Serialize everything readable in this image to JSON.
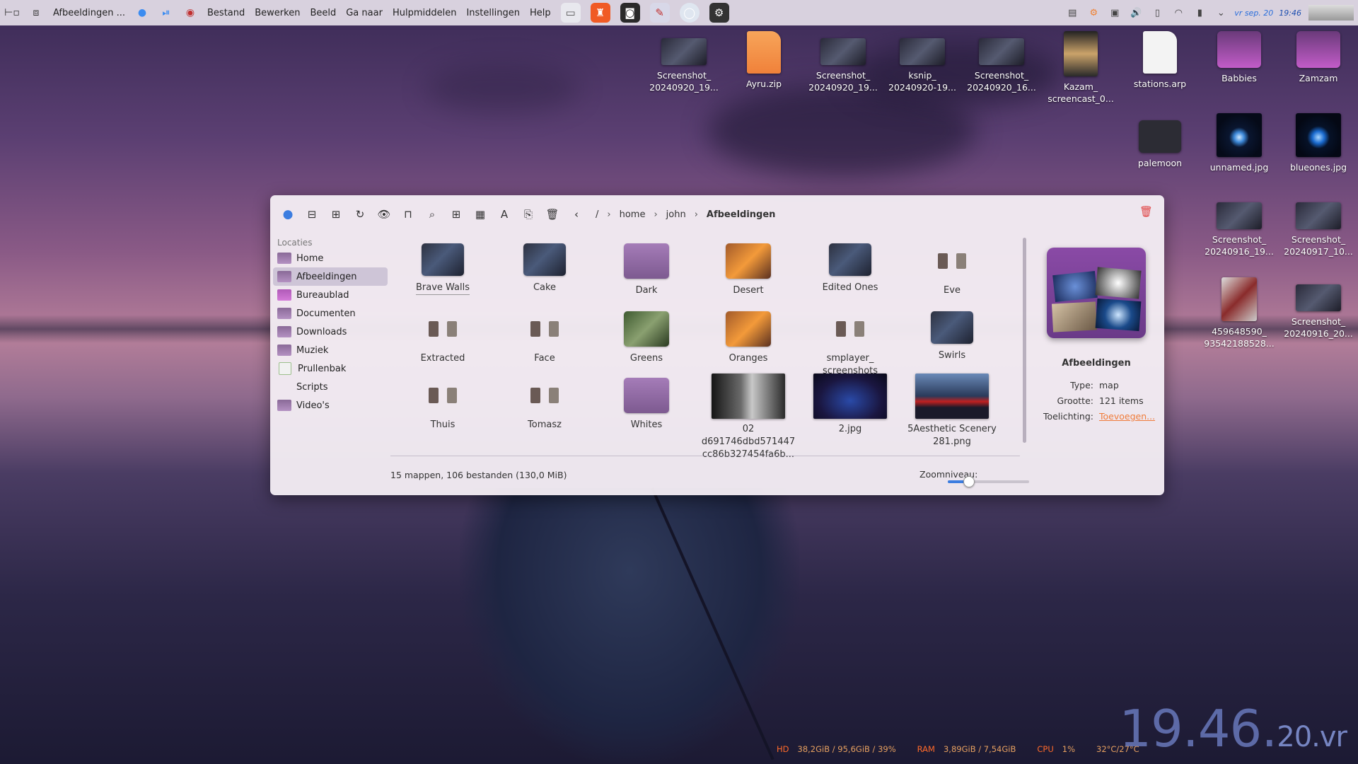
{
  "panel": {
    "window_title": "Afbeeldingen ...",
    "menu": [
      "Bestand",
      "Bewerken",
      "Beeld",
      "Ga naar",
      "Hulpmiddelen",
      "Instellingen",
      "Help"
    ],
    "date": "vr sep. 20",
    "time": "19:46"
  },
  "desktop_icons": [
    {
      "label": "Screenshot_\n20240920_19...",
      "kind": "wide"
    },
    {
      "label": "Ayru.zip",
      "kind": "zip"
    },
    {
      "label": "Screenshot_\n20240920_19...",
      "kind": "wide"
    },
    {
      "label": "ksnip_\n20240920-19...",
      "kind": "wide"
    },
    {
      "label": "Screenshot_\n20240920_16...",
      "kind": "wide"
    },
    {
      "label": "Kazam_\nscreencast_0...",
      "kind": "portrait"
    },
    {
      "label": "stations.arp",
      "kind": "txt"
    },
    {
      "label": "Babbies",
      "kind": "folder"
    },
    {
      "label": "Zamzam",
      "kind": "folder"
    },
    {
      "label": "palemoon",
      "kind": "dark"
    },
    {
      "label": "unnamed.jpg",
      "kind": "eye"
    },
    {
      "label": "blueones.jpg",
      "kind": "eye2"
    },
    {
      "label": "Screenshot_\n20240916_19...",
      "kind": "wide"
    },
    {
      "label": "Screenshot_\n20240917_10...",
      "kind": "wide"
    },
    {
      "label": "459648590_\n93542188528...",
      "kind": "red"
    },
    {
      "label": "Screenshot_\n20240916_20...",
      "kind": "wide"
    }
  ],
  "filemanager": {
    "breadcrumb": [
      "/",
      "home",
      "john",
      "Afbeeldingen"
    ],
    "sidebar_header": "Locaties",
    "sidebar": [
      "Home",
      "Afbeeldingen",
      "Bureaublad",
      "Documenten",
      "Downloads",
      "Muziek",
      "Prullenbak",
      "Scripts",
      "Video's"
    ],
    "items": [
      {
        "label": "Brave Walls",
        "kind": "thumbs"
      },
      {
        "label": "Cake",
        "kind": "thumbs"
      },
      {
        "label": "Dark",
        "kind": "plain"
      },
      {
        "label": "Desert",
        "kind": "warm"
      },
      {
        "label": "Edited Ones",
        "kind": "thumbs"
      },
      {
        "label": "Eve",
        "kind": "sparse"
      },
      {
        "label": "Extracted",
        "kind": "sparse"
      },
      {
        "label": "Face",
        "kind": "sparse"
      },
      {
        "label": "Greens",
        "kind": "green"
      },
      {
        "label": "Oranges",
        "kind": "warm"
      },
      {
        "label": "smplayer_\nscreenshots",
        "kind": "sparse"
      },
      {
        "label": "Swirls",
        "kind": "thumbs"
      },
      {
        "label": "Thuis",
        "kind": "sparse"
      },
      {
        "label": "Tomasz",
        "kind": "sparse"
      },
      {
        "label": "Whites",
        "kind": "plain"
      },
      {
        "label": "02\nd691746dbd571447\ncc86b327454fa6b...",
        "kind": "photo1"
      },
      {
        "label": "2.jpg",
        "kind": "photo2"
      },
      {
        "label": "5Aesthetic Scenery\n281.png",
        "kind": "photo3"
      }
    ],
    "status": "15 mappen, 106 bestanden (130,0 MiB)",
    "zoom_label": "Zoomniveau:",
    "zoom_fraction": 0.25,
    "info": {
      "title": "Afbeeldingen",
      "type_key": "Type:",
      "type_val": "map",
      "size_key": "Grootte:",
      "size_val": "121 items",
      "note_key": "Toelichting:",
      "note_val": "Toevoegen..."
    }
  },
  "stats": {
    "hd_label": "HD",
    "hd_val": "38,2GiB / 95,6GiB / 39%",
    "ram_label": "RAM",
    "ram_val": "3,89GiB / 7,54GiB",
    "cpu_label": "CPU",
    "cpu_val": "1%",
    "temp_val": "32°C/27°C"
  },
  "bigclock": {
    "main": "19.46.",
    "day": "20",
    "suffix": ".vr"
  }
}
